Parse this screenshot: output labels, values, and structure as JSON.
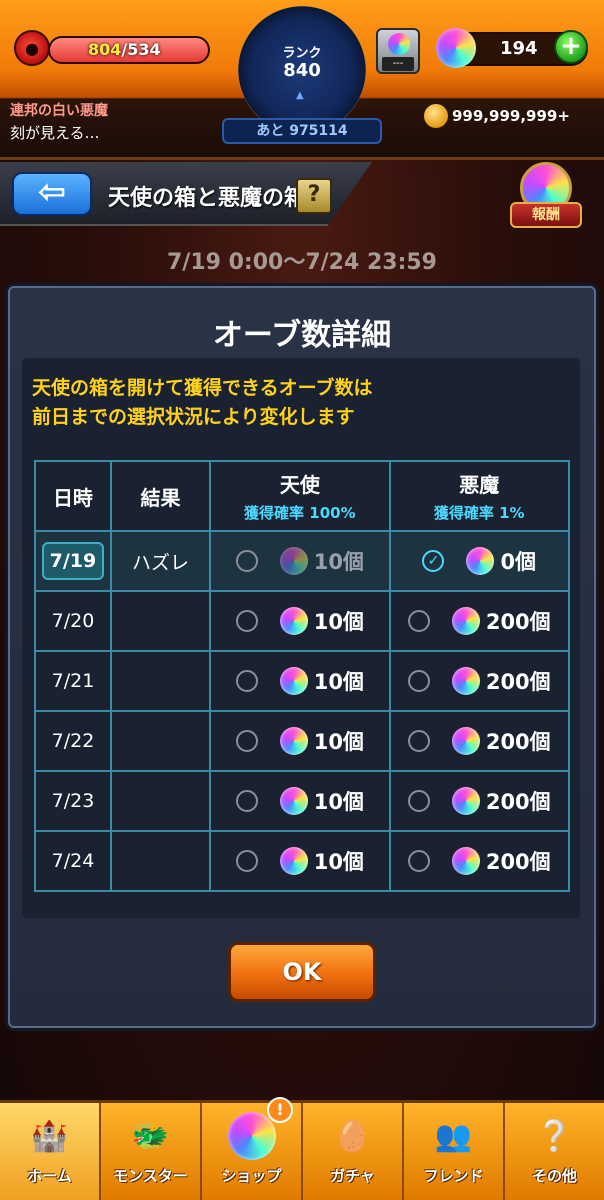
{
  "status": {
    "stamina_current": "804",
    "stamina_max": "/534",
    "rank_label": "ランク",
    "rank_value": "840",
    "exp_to_next": "あと 975114",
    "lock_label": "---",
    "orbs": "194",
    "coins": "999,999,999+",
    "user_name": "連邦の白い悪魔",
    "user_message": "刻が見える…"
  },
  "title_bar": {
    "title": "天使の箱と悪魔の箱",
    "help": "?",
    "reward_label": "報酬"
  },
  "period": "7/19 0:00〜7/24 23:59",
  "dialog": {
    "title": "オーブ数詳細",
    "notice_line1": "天使の箱を開けて獲得できるオーブ数は",
    "notice_line2": "前日までの選択状況により変化します",
    "headers": {
      "date": "日時",
      "result": "結果",
      "angel": "天使",
      "angel_rate": "獲得確率 100%",
      "devil": "悪魔",
      "devil_rate": "獲得確率 1%"
    },
    "rows": [
      {
        "date": "7/19",
        "result": "ハズレ",
        "angel": "10個",
        "devil": "0個"
      },
      {
        "date": "7/20",
        "result": "",
        "angel": "10個",
        "devil": "200個"
      },
      {
        "date": "7/21",
        "result": "",
        "angel": "10個",
        "devil": "200個"
      },
      {
        "date": "7/22",
        "result": "",
        "angel": "10個",
        "devil": "200個"
      },
      {
        "date": "7/23",
        "result": "",
        "angel": "10個",
        "devil": "200個"
      },
      {
        "date": "7/24",
        "result": "",
        "angel": "10個",
        "devil": "200個"
      }
    ],
    "ok": "OK"
  },
  "nav": {
    "home": "ホーム",
    "monster": "モンスター",
    "shop": "ショップ",
    "shop_badge": "!",
    "gacha": "ガチャ",
    "friend": "フレンド",
    "other": "その他"
  },
  "colors": {
    "accent_orange": "#f07a08",
    "table_border": "#3a8aa8",
    "notice_yellow": "#ffd21a",
    "rate_cyan": "#4ad8ff"
  },
  "stamina_fill_fraction": 1.0
}
